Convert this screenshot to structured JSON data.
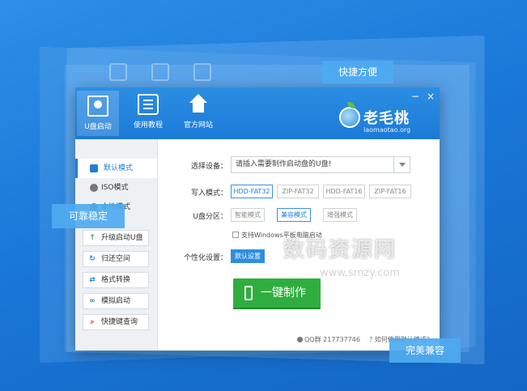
{
  "callouts": {
    "top_right": "快捷方便",
    "left": "可靠稳定",
    "bottom_right": "完美兼容"
  },
  "toolbar": {
    "items": [
      {
        "label": "U盘启动",
        "icon": "usb-boot-icon"
      },
      {
        "label": "使用教程",
        "icon": "book-icon"
      },
      {
        "label": "官方网站",
        "icon": "house-icon"
      }
    ],
    "minimize": "−",
    "close": "×"
  },
  "logo": {
    "name": "老毛桃",
    "url": "laomaotao.org"
  },
  "sidebar": {
    "modes": [
      {
        "label": "默认模式"
      },
      {
        "label": "ISO模式"
      },
      {
        "label": "本地模式"
      }
    ],
    "buttons": [
      {
        "label": "升级启动U盘",
        "icon": "upgrade-icon",
        "color": "#2fae3f"
      },
      {
        "label": "归还空间",
        "icon": "restore-icon",
        "color": "#1f7fd9"
      },
      {
        "label": "格式转换",
        "icon": "convert-icon",
        "color": "#1f7fd9"
      },
      {
        "label": "模拟启动",
        "icon": "link-icon",
        "color": "#1f7fd9"
      },
      {
        "label": "快捷键查询",
        "icon": "search-icon",
        "color": "#d9342b"
      }
    ]
  },
  "form": {
    "device_label": "选择设备：",
    "device_value": "请插入需要制作启动盘的U盘!",
    "write_mode_label": "写入模式：",
    "write_modes": [
      "HDD-FAT32",
      "ZIP-FAT32",
      "HDD-FAT16",
      "ZIP-FAT16"
    ],
    "partition_label": "U盘分区：",
    "partition_modes": [
      "智能模式",
      "兼容模式",
      "增强模式"
    ],
    "windows_tablet_label": "支持Windows平板电脑启动",
    "personalize_label": "个性化设置：",
    "personalize_value": "默认设置",
    "make_button": "一键制作"
  },
  "footer": {
    "qq": "QQ群 217737746",
    "help": "如何使用默认模式？"
  },
  "watermark": {
    "text": "数码资源网",
    "url": "www.smzy.com"
  }
}
